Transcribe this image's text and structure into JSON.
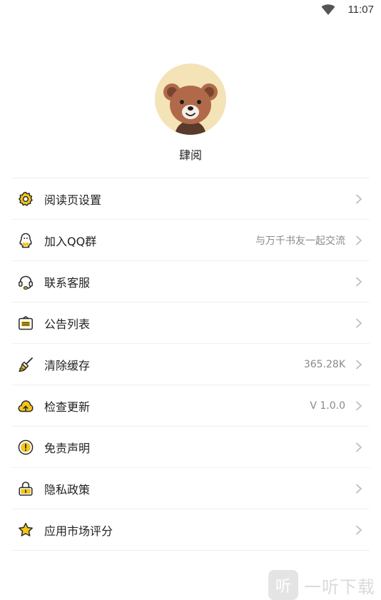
{
  "status_bar": {
    "time": "11:07"
  },
  "profile": {
    "username": "肆阅",
    "avatar_icon": "bear-avatar-icon"
  },
  "menu": {
    "items": [
      {
        "label": "阅读页设置",
        "value": "",
        "icon": "settings-gear-icon"
      },
      {
        "label": "加入QQ群",
        "value": "与万千书友一起交流",
        "icon": "qq-penguin-icon"
      },
      {
        "label": "联系客服",
        "value": "",
        "icon": "headset-icon"
      },
      {
        "label": "公告列表",
        "value": "",
        "icon": "announcement-icon"
      },
      {
        "label": "清除缓存",
        "value": "365.28K",
        "icon": "broom-icon"
      },
      {
        "label": "检查更新",
        "value": "V 1.0.0",
        "icon": "cloud-upload-icon"
      },
      {
        "label": "免责声明",
        "value": "",
        "icon": "exclamation-icon"
      },
      {
        "label": "隐私政策",
        "value": "",
        "icon": "lock-icon"
      },
      {
        "label": "应用市场评分",
        "value": "",
        "icon": "star-icon"
      }
    ]
  },
  "watermark": {
    "logo_char": "听",
    "text": "一听下载"
  },
  "colors": {
    "accent": "#f5c518",
    "icon_stroke": "#2b2b2b",
    "chevron": "#bdbdbd",
    "avatar_bg": "#f4e3b6"
  }
}
